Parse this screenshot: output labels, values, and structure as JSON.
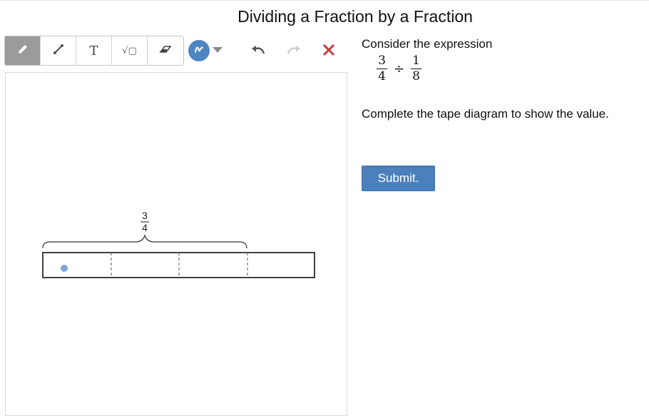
{
  "title": "Dividing a Fraction by a Fraction",
  "toolbar": {
    "tools": [
      {
        "name": "pencil-tool",
        "icon": "pencil-icon",
        "active": true
      },
      {
        "name": "line-tool",
        "icon": "line-icon",
        "active": false
      },
      {
        "name": "text-tool",
        "icon": "text-icon",
        "glyph": "T",
        "active": false
      },
      {
        "name": "math-tool",
        "icon": "sqrt-icon",
        "glyph": "√▢",
        "active": false
      },
      {
        "name": "eraser-tool",
        "icon": "eraser-icon",
        "active": false
      }
    ],
    "color_picker": {
      "color": "#4e86c2",
      "icon": "scribble-icon"
    },
    "undo_icon": "undo-icon",
    "redo_icon": "redo-icon",
    "clear_icon": "close-icon"
  },
  "tape_diagram": {
    "label": {
      "numerator": "3",
      "denominator": "4"
    },
    "bracket_spans_parts": 3,
    "total_parts": 4,
    "dot_color": "#7ea7d6"
  },
  "question": {
    "prompt": "Consider the expression",
    "expression": {
      "left": {
        "numerator": "3",
        "denominator": "4"
      },
      "operator": "÷",
      "right": {
        "numerator": "1",
        "denominator": "8"
      }
    },
    "instruction": "Complete the tape diagram to show the value.",
    "submit_label": "Submit."
  },
  "colors": {
    "accent": "#4b80bc",
    "clear_red": "#c43a3a",
    "active_tool": "#9b9b9b"
  }
}
